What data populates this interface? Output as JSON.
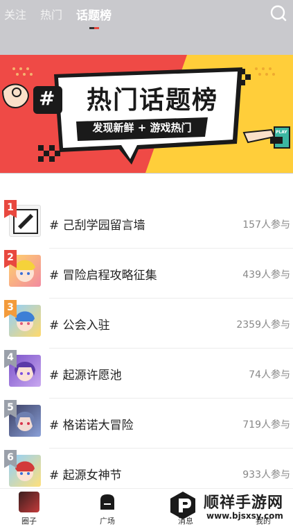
{
  "colors": {
    "header_bg": "#c9c9cd",
    "accent_red": "#e8483f",
    "accent_orange": "#f39b3b",
    "rank_gray": "#9aa0aa",
    "banner_red": "#ef4a46",
    "banner_yellow": "#ffce3a",
    "banner_black": "#1a1a1a",
    "count_gray": "#888888"
  },
  "header": {
    "tabs": [
      {
        "label": "关注"
      },
      {
        "label": "热门"
      },
      {
        "label": "话题榜",
        "active": true
      }
    ]
  },
  "banner": {
    "title": "热门话题榜",
    "subtitle": "发现新鲜 + 游戏热门",
    "hash": "#",
    "badge": "PLAY"
  },
  "topics": [
    {
      "rank": "1",
      "title": "# 己刮学园留言墙",
      "count": "157人参与",
      "rank_color": "accent_red"
    },
    {
      "rank": "2",
      "title": "# 冒险启程攻略征集",
      "count": "439人参与",
      "rank_color": "accent_red"
    },
    {
      "rank": "3",
      "title": "# 公会入驻",
      "count": "2359人参与",
      "rank_color": "accent_orange"
    },
    {
      "rank": "4",
      "title": "# 起源许愿池",
      "count": "74人参与",
      "rank_color": "rank_gray"
    },
    {
      "rank": "5",
      "title": "# 格诺诺大冒险",
      "count": "719人参与",
      "rank_color": "rank_gray"
    },
    {
      "rank": "6",
      "title": "# 起源女神节",
      "count": "933人参与",
      "rank_color": "rank_gray"
    }
  ],
  "bottom_nav": [
    {
      "label": "圈子",
      "icon": "circle-avatar-icon"
    },
    {
      "label": "广场",
      "icon": "square-icon",
      "active": true
    },
    {
      "label": "消息",
      "icon": "message-icon"
    },
    {
      "label": "我的",
      "icon": "profile-icon"
    }
  ],
  "watermark": {
    "name": "顺祥手游网",
    "url": "www.bjsxsy.com"
  }
}
